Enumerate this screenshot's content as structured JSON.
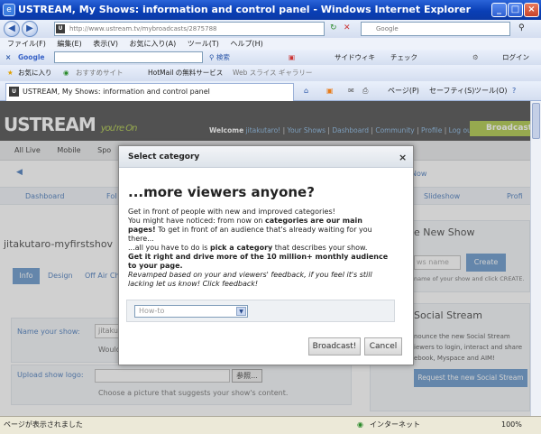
{
  "window": {
    "title": "USTREAM, My Shows: information and control panel - Windows Internet Explorer",
    "minimize": "_",
    "maximize": "□",
    "close": "×"
  },
  "address": {
    "url": "http://www.ustream.tv/mybroadcasts/2875788",
    "search_placeholder": "Google",
    "go": "↻"
  },
  "menu": [
    "ファイル(F)",
    "編集(E)",
    "表示(V)",
    "お気に入り(A)",
    "ツール(T)",
    "ヘルプ(H)"
  ],
  "toolbar": {
    "google": "Google",
    "search": "検索",
    "sidewiki": "サイドウィキ",
    "check": "チェック",
    "login": "ログイン"
  },
  "favorites": {
    "label": "お気に入り",
    "items": [
      "おすすめサイト",
      "HotMail の無料サービス",
      "Web スライス ギャラリー"
    ]
  },
  "tab": {
    "label": "USTREAM, My Shows: information and control panel",
    "cmds": [
      "ページ(P)",
      "セーフティ(S)",
      "ツール(O)"
    ]
  },
  "ustream": {
    "logo": "USTREAM",
    "tagline": "you're On",
    "welcome": "Welcome",
    "user": "jitakutaro!",
    "links": [
      "Your Shows",
      "Dashboard",
      "Community",
      "Profile",
      "Log out"
    ],
    "broadcast": "Broadcast",
    "nav": [
      "All Live",
      "Mobile",
      "Spo"
    ],
    "subnav": [
      "Dashboard",
      "Fol",
      "Slideshow",
      "Profi"
    ],
    "show_title": "jitakutaro-myfirstshov",
    "tabs": [
      "Info",
      "Design",
      "Off Air Ch"
    ],
    "name_label": "Name your show:",
    "name_value": "jitaku",
    "would": "Would",
    "logo_label": "Upload show logo:",
    "browse": "参照...",
    "logo_hint": "Choose a picture that suggests your show's content.",
    "new_show": "e New Show",
    "show_name_placeholder": "ws name",
    "create": "Create",
    "create_hint": "name of your show and click CREATE.",
    "social": "Social Stream",
    "social_text": [
      "nounce the new Social Stream",
      "iewers to login, interact and share",
      "ebook, Myspace and AIM!"
    ],
    "request": "Request the new Social Stream",
    "now": "Now"
  },
  "modal": {
    "header": "Select category",
    "close": "×",
    "heading": "...more viewers anyone?",
    "intro": "Get in front of people with new and improved categories!",
    "l2a": "You might have noticed: from now on ",
    "l2b": "categories are our main",
    "l3a": "pages!",
    "l3b": " To get in front of an audience that's already waiting for you",
    "l4": "there...",
    "l5a": "...all you have to do is ",
    "l5b": "pick a category",
    "l5c": " that describes your show.",
    "l6": "Get it right and drive more of the 10 million+ monthly audience",
    "l7": "to your page.",
    "l8": "Revamped based on your and viewers' feedback, if you feel it's still",
    "l9": "lacking let us know! Click feedback!",
    "select_value": "How-to",
    "broadcast": "Broadcast!",
    "cancel": "Cancel"
  },
  "status": {
    "text": "ページが表示されました",
    "zone": "インターネット",
    "zoom": "100%"
  }
}
